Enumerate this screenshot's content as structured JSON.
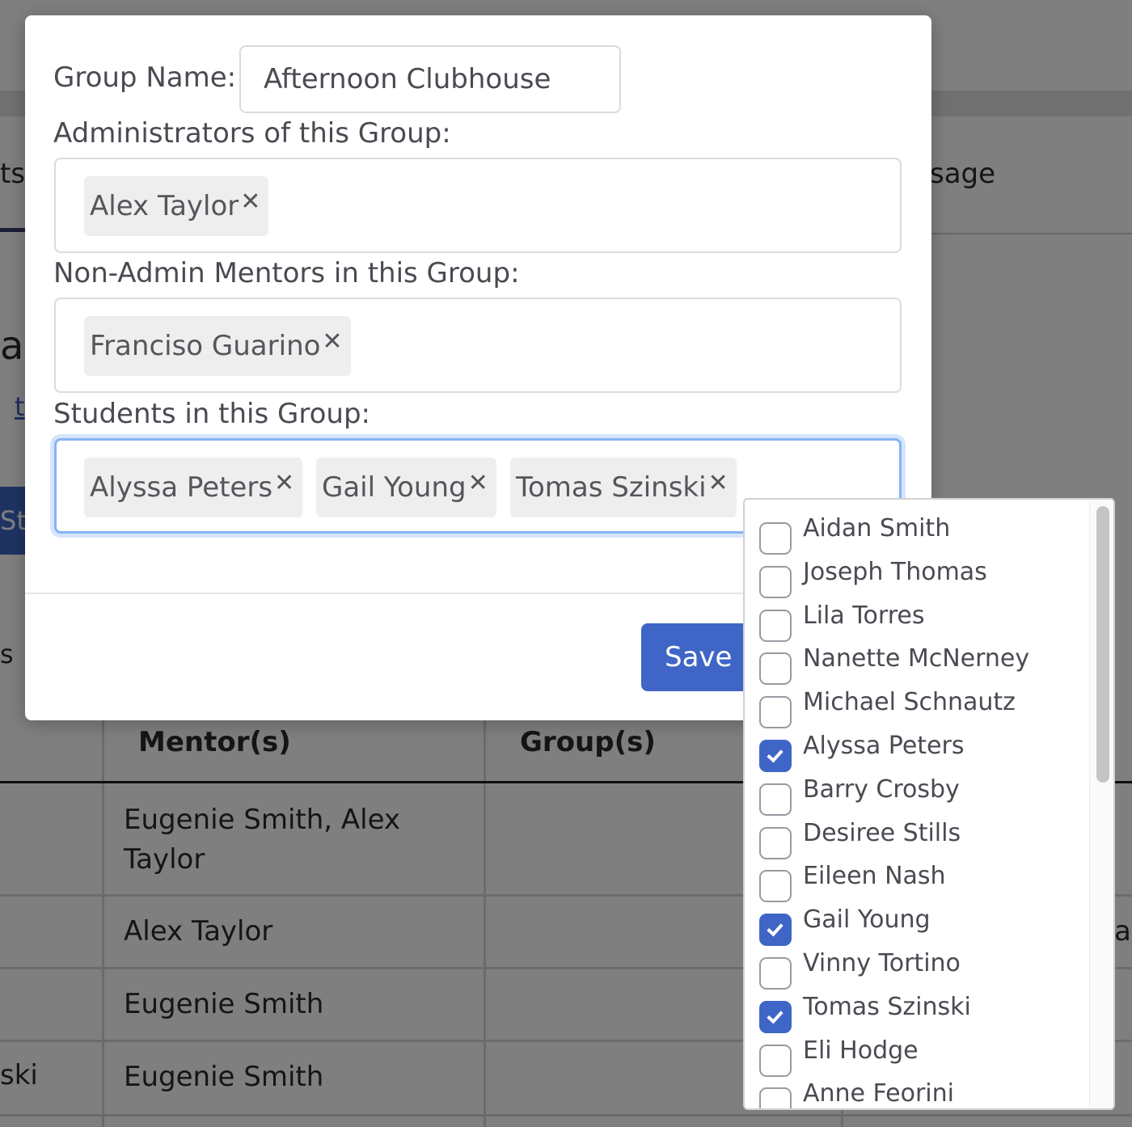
{
  "background": {
    "tab_left_fragment": "ts",
    "tab_right_fragment": "sage",
    "heading_fragment": "ag",
    "link_fragment": "t",
    "button_fragment": "St",
    "stub_s": "s",
    "table": {
      "headers": [
        "Mentor(s)",
        "Group(s)"
      ],
      "rows": [
        {
          "mentor": "Eugenie Smith, Alex Taylor",
          "left_stub": "",
          "right_stub": ""
        },
        {
          "mentor": "Alex Taylor",
          "left_stub": "",
          "right_stub": "a"
        },
        {
          "mentor": "Eugenie Smith",
          "left_stub": "",
          "right_stub": ""
        },
        {
          "mentor": "Eugenie Smith",
          "left_stub": "ski",
          "right_stub": ""
        }
      ]
    }
  },
  "modal": {
    "group_name_label": "Group Name:",
    "group_name_value": "Afternoon Clubhouse",
    "admins_label": "Administrators of this Group:",
    "admins": [
      "Alex Taylor"
    ],
    "mentors_label": "Non-Admin Mentors in this Group:",
    "mentors": [
      "Franciso Guarino"
    ],
    "students_label": "Students in this Group:",
    "students": [
      "Alyssa Peters",
      "Gail Young",
      "Tomas Szinski"
    ],
    "remove_glyph": "✕",
    "save_label": "Save"
  },
  "dropdown": {
    "options": [
      {
        "name": "Aidan Smith",
        "checked": false
      },
      {
        "name": "Joseph Thomas",
        "checked": false
      },
      {
        "name": "Lila Torres",
        "checked": false
      },
      {
        "name": "Nanette McNerney",
        "checked": false
      },
      {
        "name": "Michael Schnautz",
        "checked": false
      },
      {
        "name": "Alyssa Peters",
        "checked": true
      },
      {
        "name": "Barry Crosby",
        "checked": false
      },
      {
        "name": "Desiree Stills",
        "checked": false
      },
      {
        "name": "Eileen Nash",
        "checked": false
      },
      {
        "name": "Gail Young",
        "checked": true
      },
      {
        "name": "Vinny Tortino",
        "checked": false
      },
      {
        "name": "Tomas Szinski",
        "checked": true
      },
      {
        "name": "Eli Hodge",
        "checked": false
      },
      {
        "name": "Anne Feorini",
        "checked": false
      }
    ]
  },
  "colors": {
    "accent": "#3f66c6",
    "overlay": "rgba(0,0,0,0.5)",
    "focus_ring": "#86b4f2"
  }
}
